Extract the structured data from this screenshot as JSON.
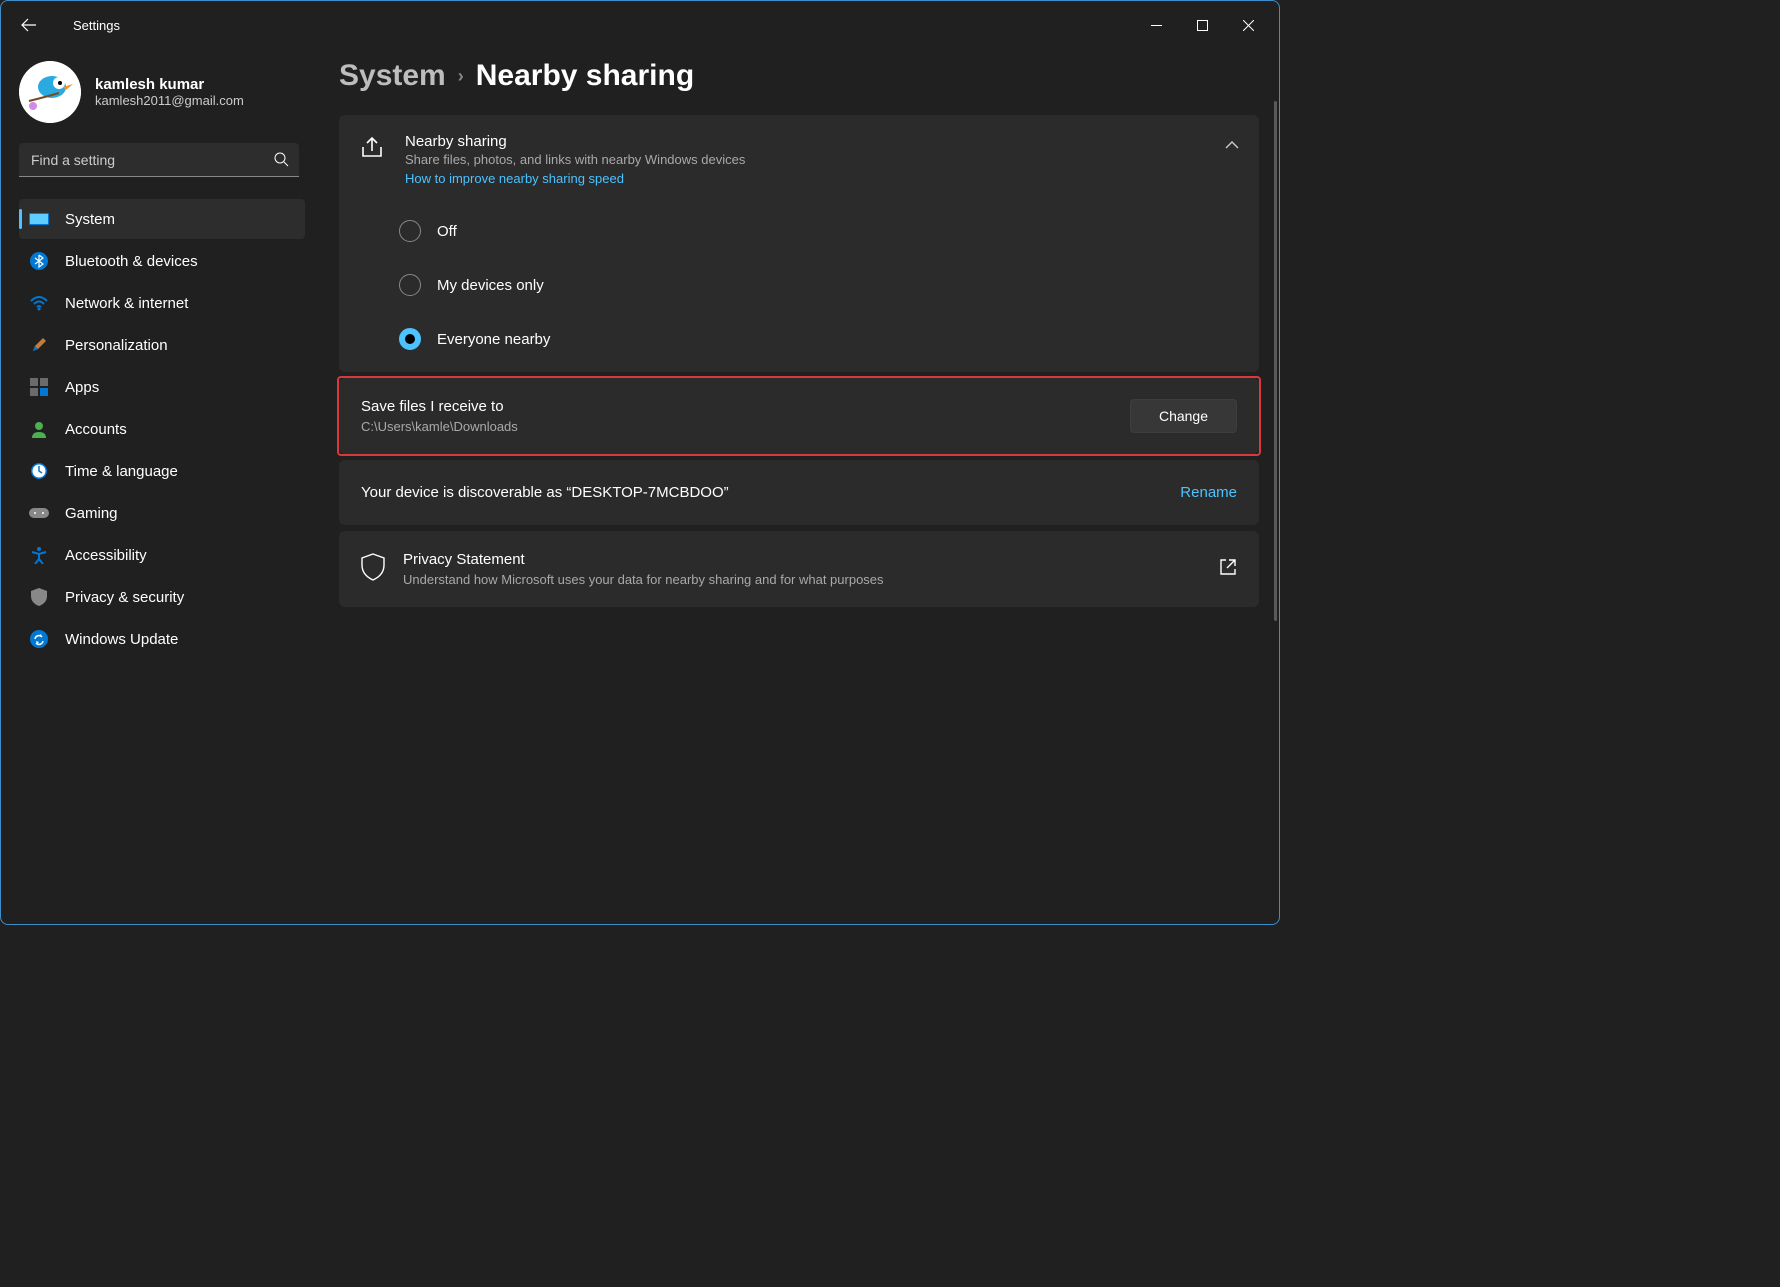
{
  "window": {
    "title": "Settings"
  },
  "user": {
    "name": "kamlesh kumar",
    "email": "kamlesh2011@gmail.com"
  },
  "search": {
    "placeholder": "Find a setting"
  },
  "nav": [
    {
      "label": "System",
      "active": true
    },
    {
      "label": "Bluetooth & devices"
    },
    {
      "label": "Network & internet"
    },
    {
      "label": "Personalization"
    },
    {
      "label": "Apps"
    },
    {
      "label": "Accounts"
    },
    {
      "label": "Time & language"
    },
    {
      "label": "Gaming"
    },
    {
      "label": "Accessibility"
    },
    {
      "label": "Privacy & security"
    },
    {
      "label": "Windows Update"
    }
  ],
  "breadcrumb": {
    "parent": "System",
    "current": "Nearby sharing"
  },
  "nearby": {
    "title": "Nearby sharing",
    "desc": "Share files, photos, and links with nearby Windows devices",
    "link": "How to improve nearby sharing speed",
    "options": [
      {
        "label": "Off",
        "selected": false
      },
      {
        "label": "My devices only",
        "selected": false
      },
      {
        "label": "Everyone nearby",
        "selected": true
      }
    ]
  },
  "save": {
    "title": "Save files I receive to",
    "path": "C:\\Users\\kamle\\Downloads",
    "button": "Change"
  },
  "discover": {
    "text": "Your device is discoverable as “DESKTOP-7MCBDOO”",
    "action": "Rename"
  },
  "privacy": {
    "title": "Privacy Statement",
    "desc": "Understand how Microsoft uses your data for nearby sharing and for what purposes"
  }
}
